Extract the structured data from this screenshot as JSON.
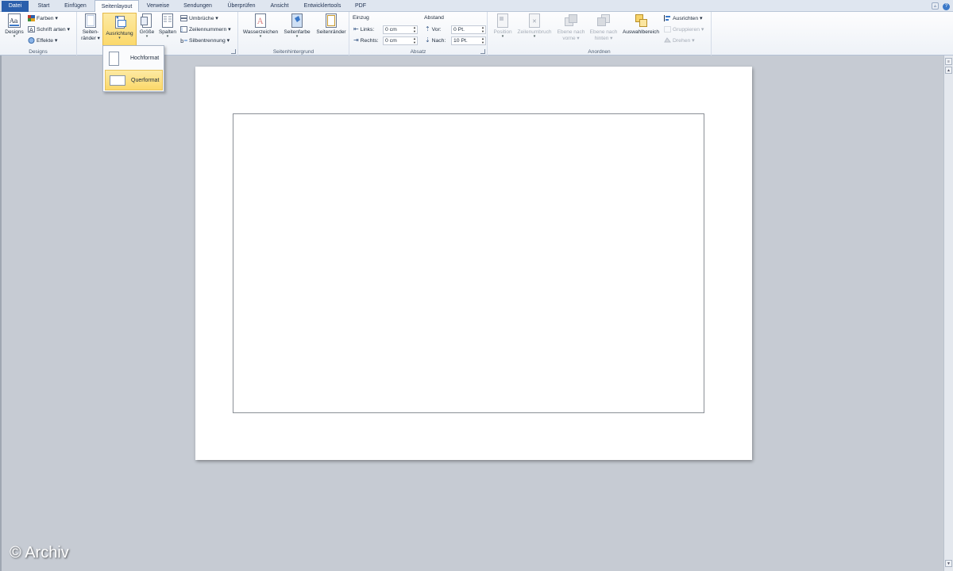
{
  "tabs": [
    {
      "label": "Datei"
    },
    {
      "label": "Start"
    },
    {
      "label": "Einfügen"
    },
    {
      "label": "Seitenlayout"
    },
    {
      "label": "Verweise"
    },
    {
      "label": "Sendungen"
    },
    {
      "label": "Überprüfen"
    },
    {
      "label": "Ansicht"
    },
    {
      "label": "Entwicklertools"
    },
    {
      "label": "PDF"
    }
  ],
  "active_tab": "Seitenlayout",
  "groups": {
    "designs": {
      "label": "Designs",
      "designs_button": "Designs",
      "farben": "Farben",
      "schriftarten": "Schrift arten",
      "effekte": "Effekte"
    },
    "seite_einrichten": {
      "label_visible": "ten",
      "seitenraender_line1": "Seiten-",
      "seitenraender_line2": "ränder",
      "ausrichtung": "Ausrichtung",
      "groesse": "Größe",
      "spalten": "Spalten",
      "umbrueche": "Umbrüche",
      "zeilennummern": "Zeilennummern",
      "silbentrennung": "Silbentrennung"
    },
    "seitenhintergrund": {
      "label": "Seitenhintergrund",
      "wasserzeichen": "Wasserzeichen",
      "seitenfarbe": "Seitenfarbe",
      "seitenraender": "Seitenränder"
    },
    "absatz": {
      "label": "Absatz",
      "einzug": "Einzug",
      "links_label": "Links:",
      "links_value": "0 cm",
      "rechts_label": "Rechts:",
      "rechts_value": "0 cm",
      "abstand": "Abstand",
      "vor_label": "Vor:",
      "vor_value": "0 Pt.",
      "nach_label": "Nach:",
      "nach_value": "10 Pt."
    },
    "anordnen": {
      "label": "Anordnen",
      "position": "Position",
      "zeilenumbruch": "Zeilenumbruch",
      "ebene_vorne_1": "Ebene nach",
      "ebene_vorne_2": "vorne",
      "ebene_hinten_1": "Ebene nach",
      "ebene_hinten_2": "hinten",
      "auswahlbereich": "Auswahlbereich",
      "ausrichten": "Ausrichten",
      "gruppieren": "Gruppieren",
      "drehen": "Drehen"
    }
  },
  "orientation_menu": {
    "items": [
      {
        "label": "Hochformat"
      },
      {
        "label": "Querformat"
      }
    ],
    "highlighted": "Querformat"
  },
  "watermark": "© Archiv",
  "colors": {
    "file_tab": "#2a5fac",
    "highlight": "#fbd86a",
    "workspace": "#c6cbd3"
  }
}
